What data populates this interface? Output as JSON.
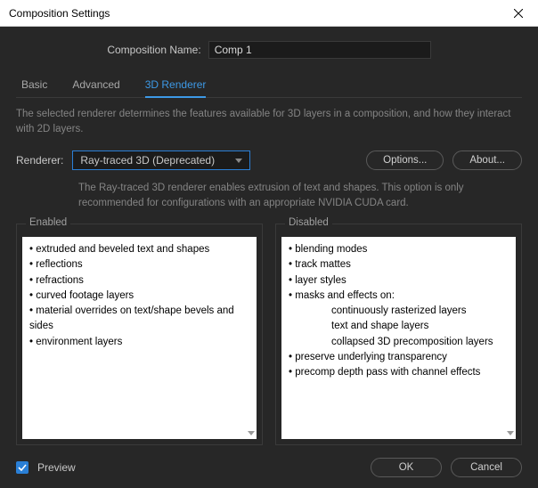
{
  "titlebar": {
    "title": "Composition Settings"
  },
  "compName": {
    "label": "Composition Name:",
    "value": "Comp 1"
  },
  "tabs": {
    "basic": "Basic",
    "advanced": "Advanced",
    "renderer3d": "3D Renderer"
  },
  "description": "The selected renderer determines the features available for 3D layers in a composition, and how they interact with 2D layers.",
  "rendererRow": {
    "label": "Renderer:",
    "value": "Ray-traced 3D (Deprecated)",
    "options": "Options...",
    "about": "About..."
  },
  "rendererDesc": "The Ray-traced 3D renderer enables extrusion of text and shapes. This option is only recommended for configurations with an appropriate NVIDIA CUDA card.",
  "enabled": {
    "title": "Enabled",
    "items": [
      "extruded and beveled text and shapes",
      "reflections",
      "refractions",
      "curved footage layers",
      "material overrides on text/shape bevels and sides",
      "environment layers"
    ]
  },
  "disabled": {
    "title": "Disabled",
    "items": [
      "blending modes",
      "track mattes",
      "layer styles",
      "masks and effects on:"
    ],
    "subitems": [
      "continuously rasterized layers",
      "text and shape layers",
      "collapsed 3D precomposition layers"
    ],
    "items2": [
      "preserve underlying transparency",
      "precomp depth pass with channel effects"
    ]
  },
  "footer": {
    "preview": "Preview",
    "ok": "OK",
    "cancel": "Cancel"
  }
}
